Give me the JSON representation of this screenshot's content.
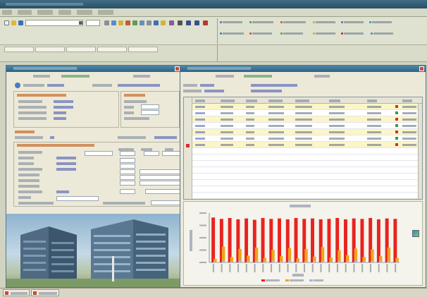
{
  "app": {
    "title": "",
    "menu": [
      "",
      "",
      "",
      "",
      "",
      ""
    ]
  },
  "toolbar": {
    "search_value": "",
    "zoom_value": "",
    "nav_buttons": [
      "",
      "",
      "",
      "",
      "",
      "",
      "",
      ""
    ],
    "tab_strip": [
      "",
      "",
      "",
      ""
    ]
  },
  "left_window": {
    "title": "",
    "header_labels": [
      "",
      "",
      ""
    ],
    "section_general": "",
    "section_dates": "",
    "section_totals": "",
    "section_detail": ""
  },
  "right_window": {
    "title": "",
    "header_labels": [
      "",
      "",
      ""
    ],
    "columns": [
      "",
      "",
      "",
      "",
      "",
      "",
      "",
      "",
      ""
    ],
    "rows": [
      [
        "",
        "",
        "",
        "",
        "",
        "",
        "",
        "",
        ""
      ],
      [
        "",
        "",
        "",
        "",
        "",
        "",
        "",
        "",
        ""
      ],
      [
        "",
        "",
        "",
        "",
        "",
        "",
        "",
        "",
        ""
      ],
      [
        "",
        "",
        "",
        "",
        "",
        "",
        "",
        "",
        ""
      ],
      [
        "",
        "",
        "",
        "",
        "",
        "",
        "",
        "",
        ""
      ],
      [
        "",
        "",
        "",
        "",
        "",
        "",
        "",
        "",
        ""
      ],
      [
        "",
        "",
        "",
        "",
        "",
        "",
        "",
        "",
        ""
      ]
    ]
  },
  "chart_data": {
    "type": "bar",
    "title": "",
    "xlabel": "",
    "ylabel": "",
    "categories": [
      "",
      "",
      "",
      "",
      "",
      "",
      "",
      "",
      "",
      "",
      "",
      "",
      "",
      "",
      "",
      "",
      "",
      "",
      "",
      "",
      "",
      "",
      ""
    ],
    "series": [
      {
        "values": [
          1.0,
          0.97,
          0.99,
          0.96,
          0.98,
          0.95,
          0.99,
          0.97,
          0.98,
          0.96,
          0.99,
          0.97,
          0.98,
          0.96,
          0.97,
          0.99,
          0.96,
          0.98,
          0.97,
          0.99,
          0.96,
          0.98,
          0.97
        ]
      },
      {
        "values": [
          0.08,
          0.35,
          0.12,
          0.3,
          0.15,
          0.33,
          0.1,
          0.28,
          0.14,
          0.32,
          0.09,
          0.3,
          0.13,
          0.34,
          0.11,
          0.27,
          0.16,
          0.31,
          0.12,
          0.29,
          0.14,
          0.33,
          0.1
        ]
      },
      {
        "values": [
          0.03,
          0.04,
          0.02,
          0.05,
          0.03,
          0.04,
          0.02,
          0.04,
          0.03,
          0.05,
          0.02,
          0.03,
          0.04,
          0.03,
          0.02,
          0.04,
          0.03,
          0.05,
          0.02,
          0.03,
          0.04,
          0.03,
          0.02
        ]
      }
    ],
    "ylim": [
      0,
      1.1
    ],
    "legend_position": "bottom",
    "colors": [
      "#e8231e",
      "#f2a21a",
      "#a9b4d9"
    ]
  },
  "status_tabs": [
    "",
    ""
  ],
  "colors": {
    "accent": "#2f6285",
    "bar_primary": "#e8231e",
    "bar_secondary": "#f2a21a",
    "selected_row": "#fbf5c8"
  }
}
